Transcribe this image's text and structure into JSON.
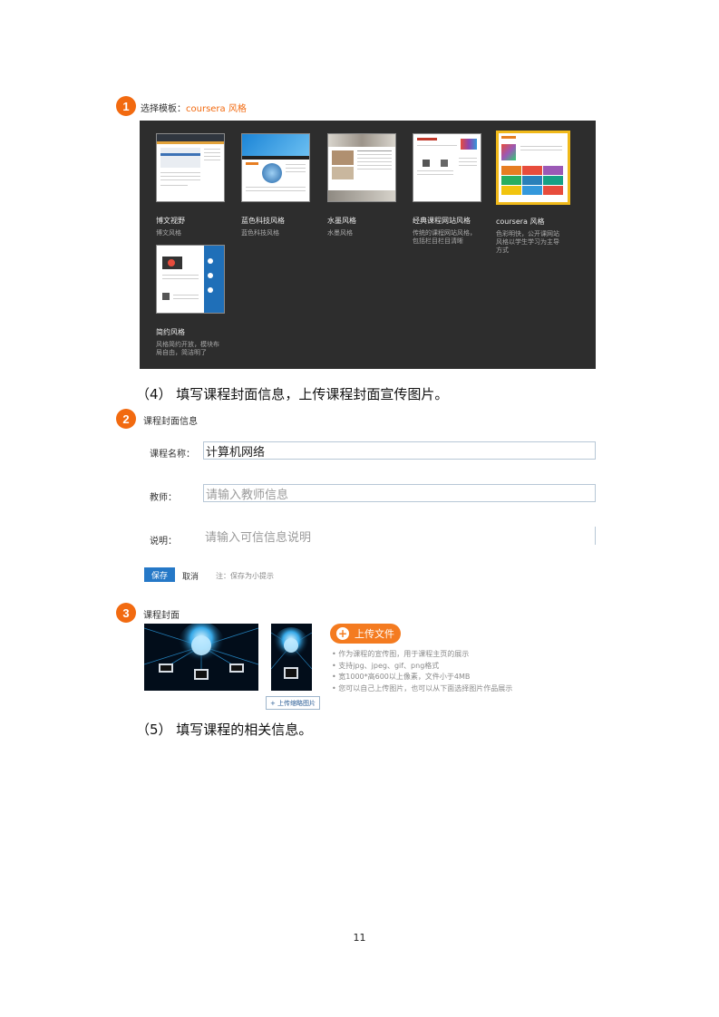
{
  "step1": {
    "badge": "1",
    "title": "选择模板：",
    "title_selected": "coursera 风格",
    "templates": [
      {
        "name": "博文视野",
        "desc": "博文风格"
      },
      {
        "name": "蓝色科技风格",
        "desc": "蓝色科技风格"
      },
      {
        "name": "水墨风格",
        "desc": "水墨风格"
      },
      {
        "name": "经典课程网站风格",
        "desc": "传统的课程网站风格，包括栏目栏目清晰"
      },
      {
        "name": "coursera 风格",
        "desc": "色彩明快，公开课网站风格以学生学习为主导方式"
      },
      {
        "name": "简约风格",
        "desc": "风格简约开放，模块布局自由，简洁明了"
      }
    ]
  },
  "caption4": "（4）  填写课程封面信息，上传课程封面宣传图片。",
  "step2": {
    "badge": "2",
    "title": "课程封面信息",
    "fields": {
      "course_name_label": "课程名称：",
      "course_name_value": "计算机网络",
      "teacher_label": "教师：",
      "teacher_placeholder": "请输入教师信息",
      "desc_label": "说明：",
      "desc_placeholder": "请输入可信信息说明"
    },
    "save_label": "保存",
    "cancel_label": "取消",
    "hint": "注：保存为小提示"
  },
  "step3": {
    "badge": "3",
    "title": "课程封面",
    "upload_label": "上传文件",
    "upload_small_label": "+ 上传缩略图片",
    "rules": [
      "作为课程的宣传图，用于课程主页的展示",
      "支持jpg、jpeg、gif、png格式",
      "宽1000*高600以上像素，文件小于4MB",
      "您可以自己上传图片，也可以从下面选择图片作品展示"
    ]
  },
  "caption5": "（5）  填写课程的相关信息。",
  "page_number": "11",
  "colors": {
    "accent": "#f26a10",
    "primary": "#2578c7",
    "panel": "#2d2d2d",
    "selected_border": "#f0b91a"
  }
}
